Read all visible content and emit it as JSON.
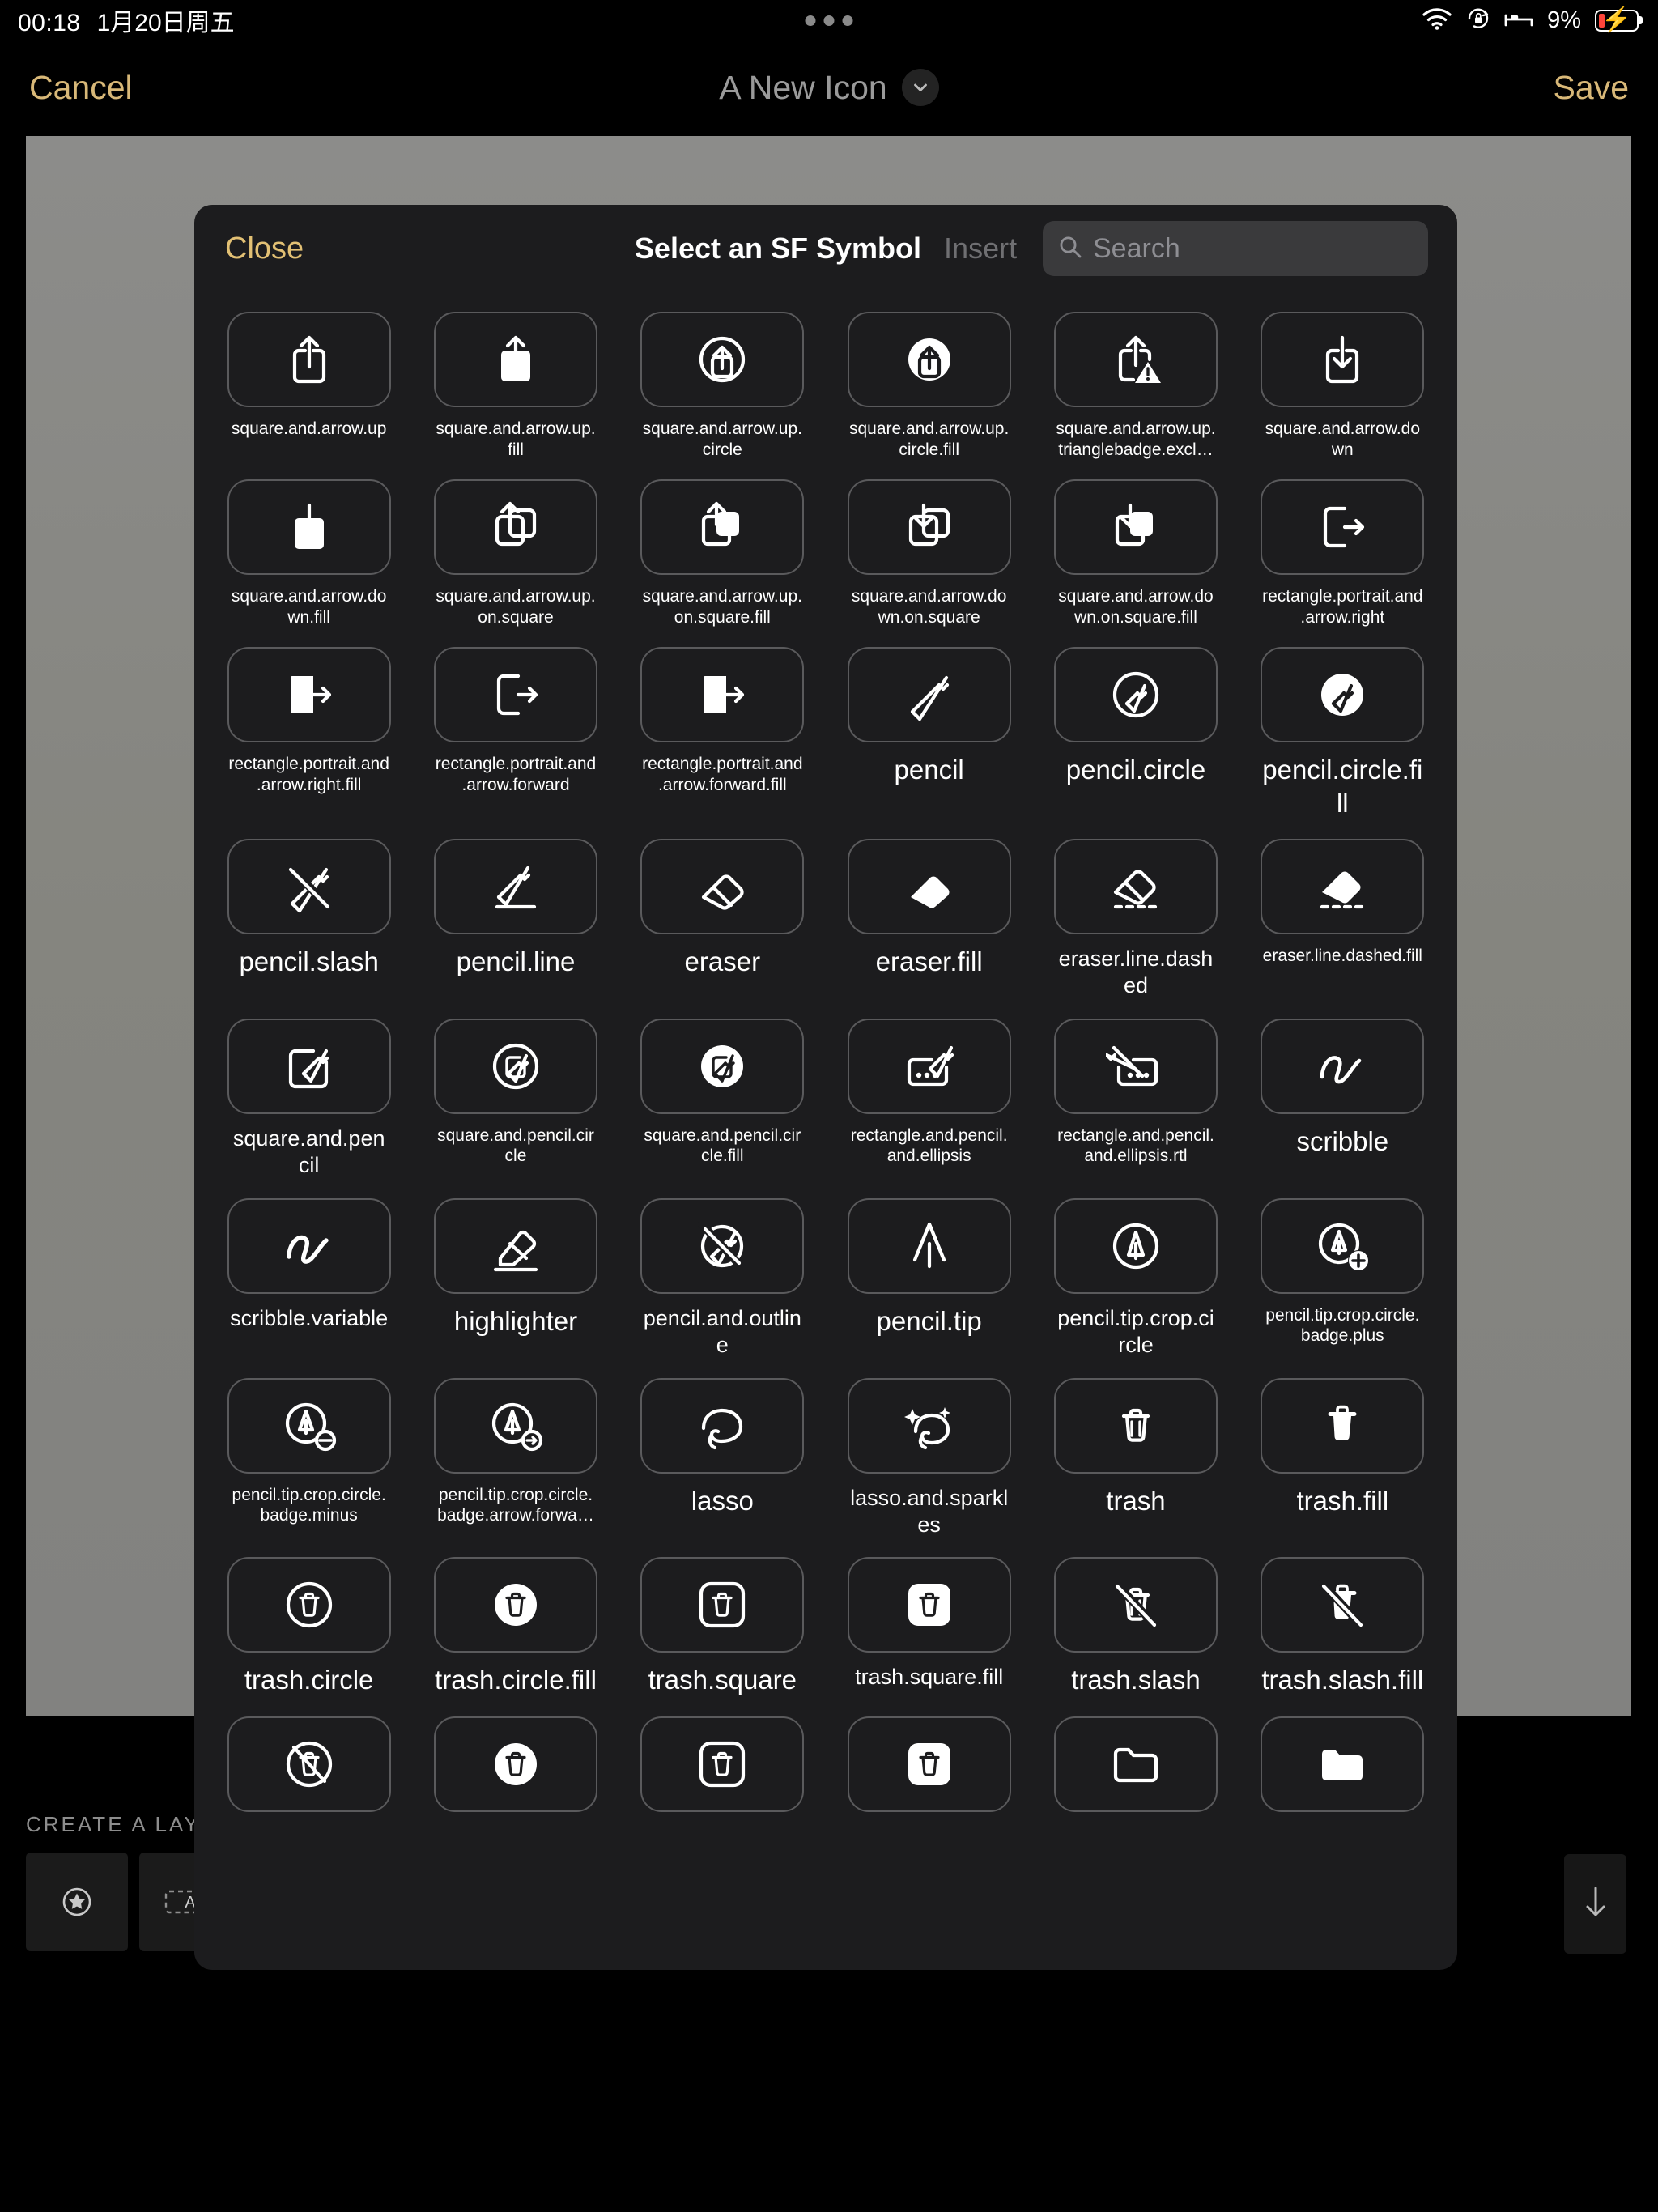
{
  "statusbar": {
    "time": "00:18",
    "date": "1月20日周五",
    "battery_percent": "9%",
    "icons": [
      "wifi-icon",
      "rotation-lock-icon",
      "sleep-focus-icon",
      "battery-charging-icon"
    ]
  },
  "navbar": {
    "cancel_label": "Cancel",
    "title": "A New Icon",
    "save_label": "Save",
    "chevron_icon": "chevron-down-icon"
  },
  "editor": {
    "create_layer_label": "CREATE A LAYER",
    "layer_tiles": [
      {
        "icon": "star-circle-icon"
      },
      {
        "icon": "text-box-icon"
      }
    ],
    "scroll_down_icon": "arrow-down-icon",
    "canvas_color": "#868684",
    "shape_color": "#9c3513"
  },
  "modal": {
    "close_label": "Close",
    "title": "Select an SF Symbol",
    "insert_label": "Insert",
    "search": {
      "placeholder": "Search",
      "value": "",
      "icon": "search-icon"
    },
    "accent_color": "#e2c074",
    "background_color": "#1c1c1e",
    "symbols": [
      {
        "name": "square.and.arrow.up",
        "icon": "square-and-arrow-up",
        "size": "s"
      },
      {
        "name": "square.and.arrow.up.fill",
        "icon": "square-and-arrow-up-fill",
        "size": "s"
      },
      {
        "name": "square.and.arrow.up.circle",
        "icon": "square-and-arrow-up-circle",
        "size": "s"
      },
      {
        "name": "square.and.arrow.up.circle.fill",
        "icon": "square-and-arrow-up-circle-fill",
        "size": "s"
      },
      {
        "name": "square.and.arrow.up.trianglebadge.excl…",
        "icon": "square-and-arrow-up-trianglebadge-exclam",
        "size": "s"
      },
      {
        "name": "square.and.arrow.down",
        "icon": "square-and-arrow-down",
        "size": "s"
      },
      {
        "name": "square.and.arrow.down.fill",
        "icon": "square-and-arrow-down-fill",
        "size": "s"
      },
      {
        "name": "square.and.arrow.up.on.square",
        "icon": "square-and-arrow-up-on-square",
        "size": "s"
      },
      {
        "name": "square.and.arrow.up.on.square.fill",
        "icon": "square-and-arrow-up-on-square-fill",
        "size": "s"
      },
      {
        "name": "square.and.arrow.down.on.square",
        "icon": "square-and-arrow-down-on-square",
        "size": "s"
      },
      {
        "name": "square.and.arrow.down.on.square.fill",
        "icon": "square-and-arrow-down-on-square-fill",
        "size": "s"
      },
      {
        "name": "rectangle.portrait.and.arrow.right",
        "icon": "rectangle-portrait-and-arrow-right",
        "size": "s"
      },
      {
        "name": "rectangle.portrait.and.arrow.right.fill",
        "icon": "rectangle-portrait-and-arrow-right-fill",
        "size": "s"
      },
      {
        "name": "rectangle.portrait.and.arrow.forward",
        "icon": "rectangle-portrait-and-arrow-forward",
        "size": "s"
      },
      {
        "name": "rectangle.portrait.and.arrow.forward.fill",
        "icon": "rectangle-portrait-and-arrow-forward-fill",
        "size": "s"
      },
      {
        "name": "pencil",
        "icon": "pencil",
        "size": "l"
      },
      {
        "name": "pencil.circle",
        "icon": "pencil-circle",
        "size": "l"
      },
      {
        "name": "pencil.circle.fill",
        "icon": "pencil-circle-fill",
        "size": "l"
      },
      {
        "name": "pencil.slash",
        "icon": "pencil-slash",
        "size": "l"
      },
      {
        "name": "pencil.line",
        "icon": "pencil-line",
        "size": "l"
      },
      {
        "name": "eraser",
        "icon": "eraser",
        "size": "l"
      },
      {
        "name": "eraser.fill",
        "icon": "eraser-fill",
        "size": "l"
      },
      {
        "name": "eraser.line.dashed",
        "icon": "eraser-line-dashed",
        "size": "m"
      },
      {
        "name": "eraser.line.dashed.fill",
        "icon": "eraser-line-dashed-fill",
        "size": "s"
      },
      {
        "name": "square.and.pencil",
        "icon": "square-and-pencil",
        "size": "m"
      },
      {
        "name": "square.and.pencil.circle",
        "icon": "square-and-pencil-circle",
        "size": "s"
      },
      {
        "name": "square.and.pencil.circle.fill",
        "icon": "square-and-pencil-circle-fill",
        "size": "s"
      },
      {
        "name": "rectangle.and.pencil.and.ellipsis",
        "icon": "rectangle-and-pencil-and-ellipsis",
        "size": "s"
      },
      {
        "name": "rectangle.and.pencil.and.ellipsis.rtl",
        "icon": "rectangle-and-pencil-and-ellipsis-rtl",
        "size": "s"
      },
      {
        "name": "scribble",
        "icon": "scribble",
        "size": "l"
      },
      {
        "name": "scribble.variable",
        "icon": "scribble-variable",
        "size": "m"
      },
      {
        "name": "highlighter",
        "icon": "highlighter",
        "size": "l"
      },
      {
        "name": "pencil.and.outline",
        "icon": "pencil-and-outline",
        "size": "m"
      },
      {
        "name": "pencil.tip",
        "icon": "pencil-tip",
        "size": "l"
      },
      {
        "name": "pencil.tip.crop.circle",
        "icon": "pencil-tip-crop-circle",
        "size": "m"
      },
      {
        "name": "pencil.tip.crop.circle.badge.plus",
        "icon": "pencil-tip-crop-circle-badge-plus",
        "size": "s"
      },
      {
        "name": "pencil.tip.crop.circle.badge.minus",
        "icon": "pencil-tip-crop-circle-badge-minus",
        "size": "s"
      },
      {
        "name": "pencil.tip.crop.circle.badge.arrow.forwa…",
        "icon": "pencil-tip-crop-circle-badge-arrow-forward",
        "size": "s"
      },
      {
        "name": "lasso",
        "icon": "lasso",
        "size": "l"
      },
      {
        "name": "lasso.and.sparkles",
        "icon": "lasso-and-sparkles",
        "size": "m"
      },
      {
        "name": "trash",
        "icon": "trash",
        "size": "l"
      },
      {
        "name": "trash.fill",
        "icon": "trash-fill",
        "size": "l"
      },
      {
        "name": "trash.circle",
        "icon": "trash-circle",
        "size": "l"
      },
      {
        "name": "trash.circle.fill",
        "icon": "trash-circle-fill",
        "size": "l"
      },
      {
        "name": "trash.square",
        "icon": "trash-square",
        "size": "l"
      },
      {
        "name": "trash.square.fill",
        "icon": "trash-square-fill",
        "size": "m"
      },
      {
        "name": "trash.slash",
        "icon": "trash-slash",
        "size": "l"
      },
      {
        "name": "trash.slash.fill",
        "icon": "trash-slash-fill",
        "size": "l"
      },
      {
        "name": "",
        "icon": "trash-slash-circle",
        "size": "s"
      },
      {
        "name": "",
        "icon": "trash-slash-circle-fill",
        "size": "s"
      },
      {
        "name": "",
        "icon": "trash-slash-square",
        "size": "s"
      },
      {
        "name": "",
        "icon": "trash-slash-square-fill",
        "size": "s"
      },
      {
        "name": "",
        "icon": "folder",
        "size": "s"
      },
      {
        "name": "",
        "icon": "folder-fill",
        "size": "s"
      }
    ]
  }
}
